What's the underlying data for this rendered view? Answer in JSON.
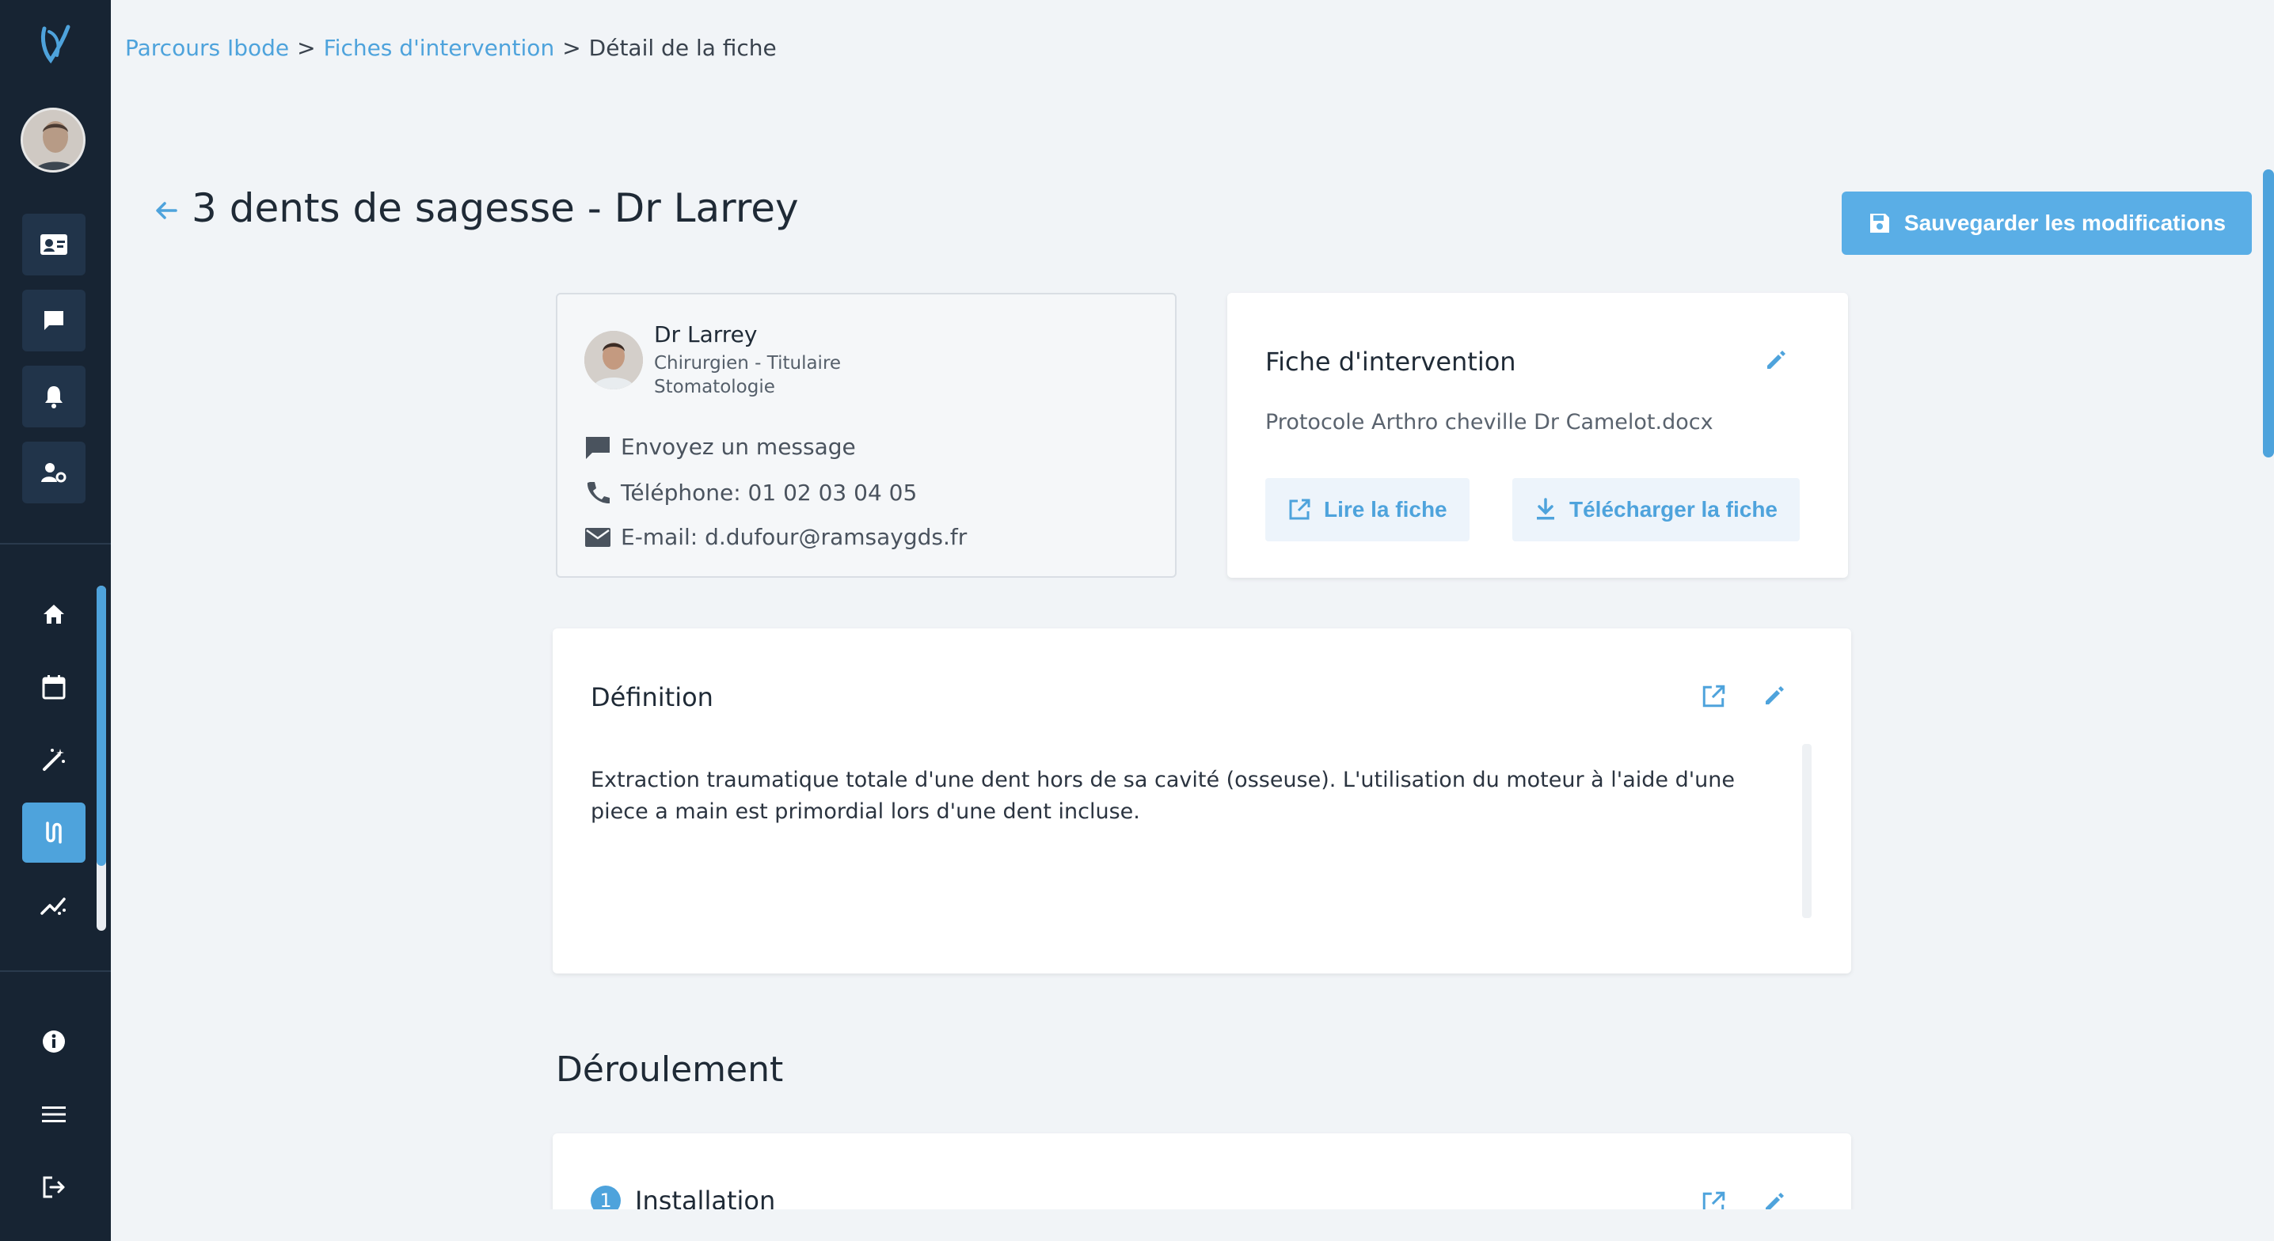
{
  "breadcrumb": {
    "item1": "Parcours Ibode",
    "item2": "Fiches d'intervention",
    "current": "Détail de la fiche",
    "separator": ">"
  },
  "page": {
    "title": "3 dents de sagesse - Dr Larrey",
    "save_label": "Sauvegarder les modifications"
  },
  "surgeon": {
    "name": "Dr Larrey",
    "role": "Chirurgien - Titulaire",
    "specialty": "Stomatologie",
    "message": "Envoyez un message",
    "phone": "Téléphone: 01 02 03 04 05",
    "email": "E-mail: d.dufour@ramsaygds.fr"
  },
  "fiche": {
    "title": "Fiche d'intervention",
    "file": "Protocole Arthro cheville Dr Camelot.docx",
    "read_label": "Lire la fiche",
    "download_label": "Télécharger la fiche"
  },
  "definition": {
    "title": "Définition",
    "text": "Extraction traumatique totale d'une dent hors de sa cavité (osseuse). L'utilisation du moteur à l'aide d'une piece a main est primordial lors d'une dent incluse."
  },
  "deroulement": {
    "title": "Déroulement",
    "step_number": "1",
    "step_title": "Installation"
  },
  "colors": {
    "sidebar": "#172433",
    "accent": "#4ea3dc",
    "background": "#f1f4f7"
  },
  "sidebar_icons": [
    "logo-icon",
    "contact-card-icon",
    "chat-icon",
    "bell-icon",
    "user-settings-icon",
    "home-icon",
    "calendar-icon",
    "magic-wand-icon",
    "route-icon",
    "analytics-icon",
    "info-icon",
    "menu-icon",
    "logout-icon"
  ]
}
